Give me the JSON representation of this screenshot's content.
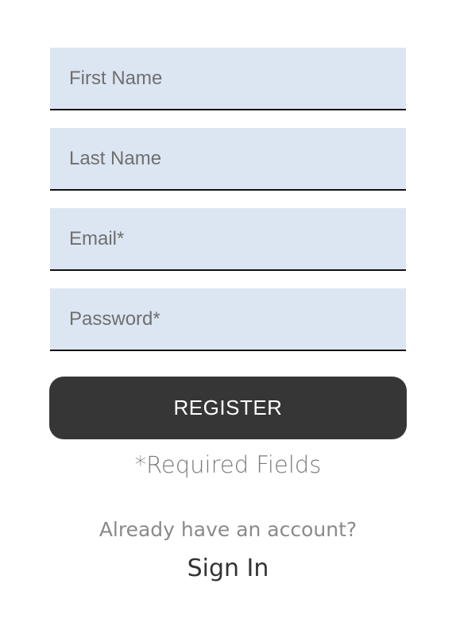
{
  "form": {
    "fields": [
      {
        "name": "first-name",
        "placeholder": "First Name",
        "value": ""
      },
      {
        "name": "last-name",
        "placeholder": "Last Name",
        "value": ""
      },
      {
        "name": "email",
        "placeholder": "Email*",
        "value": ""
      },
      {
        "name": "password",
        "placeholder": "Password*",
        "value": ""
      }
    ],
    "register_label": "REGISTER",
    "required_note": "*Required Fields"
  },
  "footer": {
    "prompt": "Already have an account?",
    "sign_in_label": "Sign In"
  },
  "colors": {
    "field_background": "#dce6f2",
    "button_background": "#363636",
    "button_text": "#ffffff"
  }
}
